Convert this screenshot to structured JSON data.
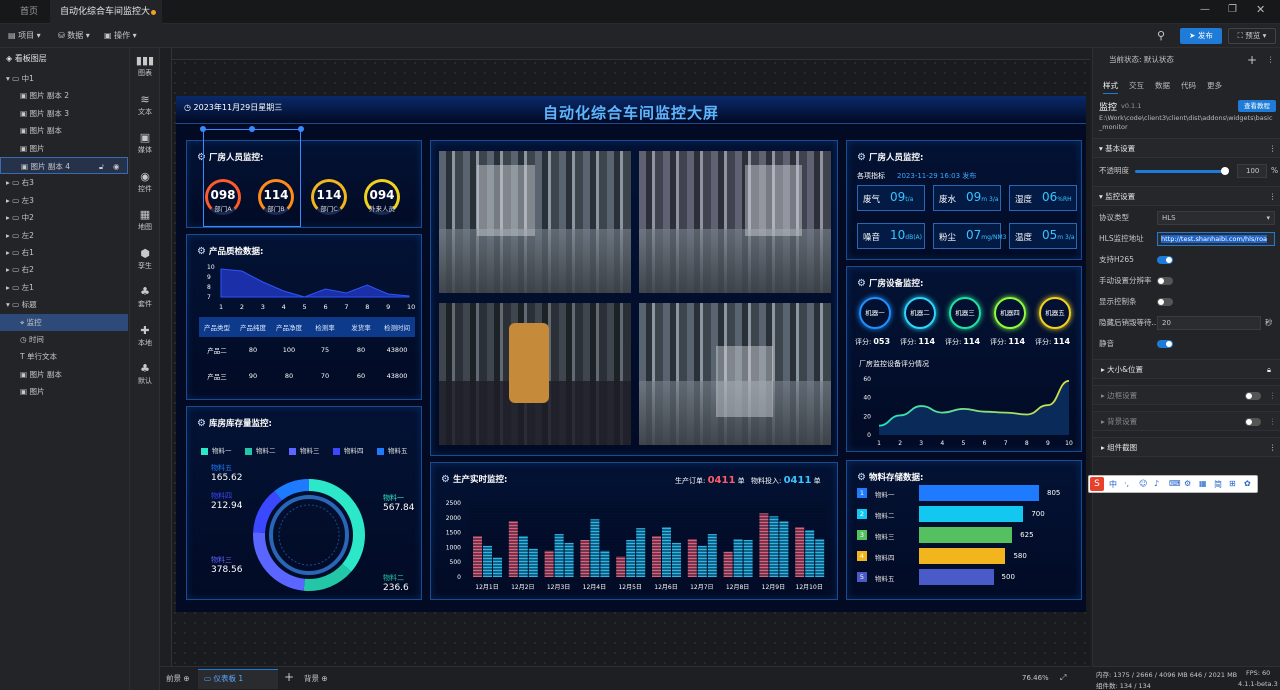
{
  "tabs": {
    "home": "首页",
    "active": "自动化综合车间监控大屏"
  },
  "toolbar": {
    "project": "项目",
    "data": "数据",
    "ops": "操作",
    "publish": "发布",
    "preview": "预览"
  },
  "layers": {
    "title": "看板图层",
    "items": [
      {
        "label": "中1",
        "depth": 0,
        "kind": "folder-open"
      },
      {
        "label": "图片 副本 2",
        "depth": 1,
        "kind": "image"
      },
      {
        "label": "图片 副本 3",
        "depth": 1,
        "kind": "image"
      },
      {
        "label": "图片 副本",
        "depth": 1,
        "kind": "image"
      },
      {
        "label": "图片",
        "depth": 1,
        "kind": "image"
      },
      {
        "label": "图片 副本 4",
        "depth": 1,
        "kind": "image",
        "selected": true
      },
      {
        "label": "右3",
        "depth": 0,
        "kind": "folder"
      },
      {
        "label": "左3",
        "depth": 0,
        "kind": "folder"
      },
      {
        "label": "中2",
        "depth": 0,
        "kind": "folder"
      },
      {
        "label": "左2",
        "depth": 0,
        "kind": "folder"
      },
      {
        "label": "右1",
        "depth": 0,
        "kind": "folder"
      },
      {
        "label": "右2",
        "depth": 0,
        "kind": "folder"
      },
      {
        "label": "左1",
        "depth": 0,
        "kind": "folder"
      },
      {
        "label": "标题",
        "depth": 0,
        "kind": "folder-open"
      },
      {
        "label": "监控",
        "depth": 1,
        "kind": "monitor",
        "active": true
      },
      {
        "label": "时间",
        "depth": 1,
        "kind": "clock"
      },
      {
        "label": "单行文本",
        "depth": 1,
        "kind": "text"
      },
      {
        "label": "图片 副本",
        "depth": 1,
        "kind": "image"
      },
      {
        "label": "图片",
        "depth": 1,
        "kind": "image"
      }
    ]
  },
  "widgets": [
    {
      "label": "图表",
      "icon": "chart-icon"
    },
    {
      "label": "文本",
      "icon": "text-icon"
    },
    {
      "label": "媒体",
      "icon": "media-icon"
    },
    {
      "label": "控件",
      "icon": "control-icon"
    },
    {
      "label": "地图",
      "icon": "map-icon"
    },
    {
      "label": "孪生",
      "icon": "twin-icon"
    },
    {
      "label": "套件",
      "icon": "kit-icon"
    },
    {
      "label": "本地",
      "icon": "local-icon"
    },
    {
      "label": "默认",
      "icon": "default-icon"
    }
  ],
  "dashboard": {
    "title": "自动化综合车间监控大屏",
    "datetime": "2023年11月29日星期三",
    "staff": {
      "title": "厂房人员监控:",
      "rings": [
        {
          "value": "098",
          "label": "部门A",
          "color": "#ff5a2a"
        },
        {
          "value": "114",
          "label": "部门B",
          "color": "#ff8c1a"
        },
        {
          "value": "114",
          "label": "部门C",
          "color": "#f2b51e"
        },
        {
          "value": "094",
          "label": "外来人员",
          "color": "#f2d21e"
        }
      ]
    },
    "quality": {
      "title": "产品质检数据:",
      "headers": [
        "产品类型",
        "产品纯度",
        "产品净度",
        "检测率",
        "发货率",
        "检测时间"
      ],
      "rows": [
        [
          "产品二",
          "80",
          "100",
          "75",
          "80",
          "43800"
        ],
        [
          "产品三",
          "90",
          "80",
          "70",
          "60",
          "43800"
        ]
      ]
    },
    "stock": {
      "title": "库房库存量监控:",
      "items": [
        {
          "name": "物料一",
          "value": "567.84",
          "color": "#2de8c8"
        },
        {
          "name": "物料二",
          "value": "236.6",
          "color": "#22c7a8"
        },
        {
          "name": "物料三",
          "value": "378.56",
          "color": "#5a66ff"
        },
        {
          "name": "物料四",
          "value": "212.94",
          "color": "#3a48ff"
        },
        {
          "name": "物料五",
          "value": "165.62",
          "color": "#1e7bff"
        }
      ]
    },
    "env": {
      "title": "厂房人员监控:",
      "subtitle": "各项指标",
      "published": "2023-11-29 16:03 发布",
      "items": [
        {
          "k": "废气",
          "v": "09",
          "u": "t/a"
        },
        {
          "k": "废水",
          "v": "09",
          "u": "m 3/a"
        },
        {
          "k": "湿度",
          "v": "06",
          "u": "%RH"
        },
        {
          "k": "噪音",
          "v": "10",
          "u": "dB(A)"
        },
        {
          "k": "粉尘",
          "v": "07",
          "u": "mg/NM3"
        },
        {
          "k": "温度",
          "v": "05",
          "u": "m 3/a"
        }
      ]
    },
    "devices": {
      "title": "厂房设备监控:",
      "chart_title": "厂房监控设备评分情况",
      "items": [
        {
          "name": "机器一",
          "score": "053",
          "color": "#1e90ff"
        },
        {
          "name": "机器二",
          "score": "114",
          "color": "#2ad8ff"
        },
        {
          "name": "机器三",
          "score": "114",
          "color": "#22e0a0"
        },
        {
          "name": "机器四",
          "score": "114",
          "color": "#8aff3a"
        },
        {
          "name": "机器五",
          "score": "114",
          "color": "#f2d21e"
        }
      ],
      "score_prefix": "评分:"
    },
    "production": {
      "title": "生产实时监控:",
      "order_label": "生产订单:",
      "order": "0411",
      "order_unit": "单",
      "input_label": "物料投入:",
      "input": "0411",
      "input_unit": "单"
    },
    "materials": {
      "title": "物料存储数据:"
    }
  },
  "chart_data": [
    {
      "type": "area",
      "id": "quality-trend",
      "x": [
        1,
        2,
        3,
        4,
        5,
        6,
        7,
        8,
        9,
        10
      ],
      "y": [
        9.8,
        9.6,
        8.5,
        7.6,
        7.0,
        7.8,
        7.4,
        8.2,
        7.3,
        7.1
      ],
      "ylim": [
        7,
        10
      ],
      "yticks": [
        7,
        8,
        9,
        10
      ],
      "color": "#2a56ff"
    },
    {
      "type": "pie",
      "id": "stock-donut",
      "categories": [
        "物料一",
        "物料二",
        "物料三",
        "物料四",
        "物料五"
      ],
      "values": [
        567.84,
        236.6,
        378.56,
        212.94,
        165.62
      ]
    },
    {
      "type": "area",
      "id": "device-score",
      "x": [
        1,
        2,
        3,
        4,
        5,
        6,
        7,
        8,
        9,
        10
      ],
      "y": [
        10,
        21,
        31,
        24,
        28,
        25,
        24,
        22,
        32,
        58
      ],
      "ylim": [
        0,
        60
      ],
      "yticks": [
        0,
        20,
        40,
        60
      ]
    },
    {
      "type": "bar",
      "id": "production",
      "categories": [
        "12月1日",
        "12月2日",
        "12月3日",
        "12月4日",
        "12月5日",
        "12月6日",
        "12月7日",
        "12月8日",
        "12月9日",
        "12月10日"
      ],
      "series": [
        {
          "values": [
            1400,
            1900,
            900,
            1250,
            700,
            1400,
            1300,
            850,
            2150,
            1700
          ],
          "color": "#e0607a"
        },
        {
          "values": [
            1050,
            1400,
            1450,
            1950,
            1250,
            1700,
            1050,
            1300,
            2050,
            1600
          ],
          "color": "#2ab8e8"
        },
        {
          "values": [
            650,
            950,
            1150,
            900,
            1650,
            1150,
            1450,
            1250,
            1900,
            1300
          ],
          "color": "#2ab8e8"
        }
      ],
      "ylim": [
        0,
        2500
      ],
      "yticks": [
        0,
        500,
        1000,
        1500,
        2000,
        2500
      ]
    },
    {
      "type": "bar",
      "id": "materials",
      "orientation": "horizontal",
      "categories": [
        "物料一",
        "物料二",
        "物料三",
        "物料四",
        "物料五"
      ],
      "values": [
        805,
        700,
        625,
        580,
        500
      ],
      "colors": [
        "#1e7bff",
        "#13c8f0",
        "#55c060",
        "#f2b51e",
        "#4a5ac8"
      ],
      "xlim": [
        0,
        805
      ]
    }
  ],
  "props": {
    "state_label": "当前状态:",
    "state": "默认状态",
    "tabs": [
      "样式",
      "交互",
      "数据",
      "代码",
      "更多"
    ],
    "widget_name": "监控",
    "version": "v0.1.1",
    "tutorial": "查看教程",
    "path": "E:\\Work\\code\\client3\\client\\dist\\addons\\widgets\\basic_monitor",
    "basic": "基本设置",
    "opacity_label": "不透明度",
    "opacity": "100",
    "opacity_unit": "%",
    "monitor_settings": "监控设置",
    "protocol_label": "协议类型",
    "protocol": "HLS",
    "url_label": "HLS监控地址",
    "url": "http://test.shanhaibi.com/hls/roa",
    "h265": "支持H265",
    "resolution": "手动设置分辨率",
    "showbar": "显示控制条",
    "hide_label": "隐藏后销毁等待...",
    "hide_value": "20",
    "hide_unit": "秒",
    "mute": "静音",
    "size": "大小&位置",
    "border": "边框设置",
    "bg": "背景设置",
    "screenshot": "组件截图"
  },
  "bottom": {
    "front": "前景",
    "page": "仪表板 1",
    "back": "背景",
    "zoom": "76.46%"
  },
  "status": {
    "mem": "内存: 1375 / 2666 / 4096 MB  646 / 2021 MB",
    "fps": "FPS: 60",
    "count": "组件数: 134 / 134",
    "ver": "4.1.1-beta.3"
  },
  "ime": [
    "中",
    "·,",
    "☺",
    "♪",
    "⌨",
    "⚙",
    "▦",
    "简",
    "⊞",
    "✿"
  ]
}
